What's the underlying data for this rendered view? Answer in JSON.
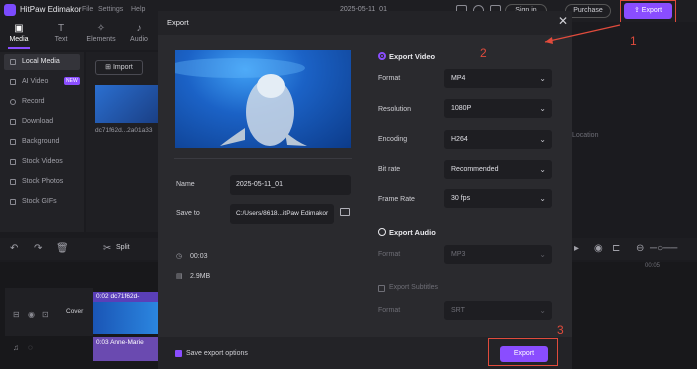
{
  "app": {
    "name": "HitPaw Edimakor",
    "menus": [
      "File",
      "Settings",
      "Help"
    ],
    "date": "2025-05-11_01"
  },
  "header_right": {
    "signin": "Sign in",
    "purchase": "Purchase",
    "export": "Export"
  },
  "tabs": [
    {
      "label": "Media",
      "icon": "media-icon"
    },
    {
      "label": "Text",
      "icon": "text-icon"
    },
    {
      "label": "Elements",
      "icon": "elements-icon"
    },
    {
      "label": "Audio",
      "icon": "audio-icon"
    }
  ],
  "sidebar": {
    "items": [
      {
        "label": "Local Media"
      },
      {
        "label": "AI Video",
        "badge": "NEW"
      },
      {
        "label": "Record"
      },
      {
        "label": "Download"
      },
      {
        "label": "Background"
      },
      {
        "label": "Stock Videos"
      },
      {
        "label": "Stock Photos"
      },
      {
        "label": "Stock GIFs"
      }
    ]
  },
  "media": {
    "import_label": "Import",
    "thumb_caption": "dc71f62d...2a01a33"
  },
  "right_panel": {
    "location_text": "Location"
  },
  "toolbar": {
    "split_label": "Split",
    "ruler_label": "00:05"
  },
  "timeline": {
    "cover_label": "Cover",
    "clip1_label": "0:02 dc71f62d-",
    "clip2_label": "0:03 Anne-Marie"
  },
  "dialog": {
    "title": "Export",
    "name_label": "Name",
    "name_value": "2025-05-11_01",
    "saveto_label": "Save to",
    "saveto_value": "C:/Users/8618...itPaw Edimakor",
    "duration": "00:03",
    "size": "2.9MB",
    "export_video_label": "Export Video",
    "export_audio_label": "Export Audio",
    "export_subtitles_label": "Export Subtitles",
    "video_settings": [
      {
        "label": "Format",
        "value": "MP4"
      },
      {
        "label": "Resolution",
        "value": "1080P"
      },
      {
        "label": "Encoding",
        "value": "H264"
      },
      {
        "label": "Bit rate",
        "value": "Recommended"
      },
      {
        "label": "Frame Rate",
        "value": "30  fps"
      }
    ],
    "audio_format": {
      "label": "Format",
      "value": "MP3"
    },
    "subtitle_format": {
      "label": "Format",
      "value": "SRT"
    },
    "save_options_label": "Save export options",
    "export_button": "Export"
  },
  "annotations": {
    "step1": "1",
    "step2": "2",
    "step3": "3",
    "color": "#e04b3c"
  },
  "colors": {
    "accent": "#8a4dff",
    "dialog_bg": "#2a2a2e",
    "app_bg": "#1b1b1f"
  }
}
